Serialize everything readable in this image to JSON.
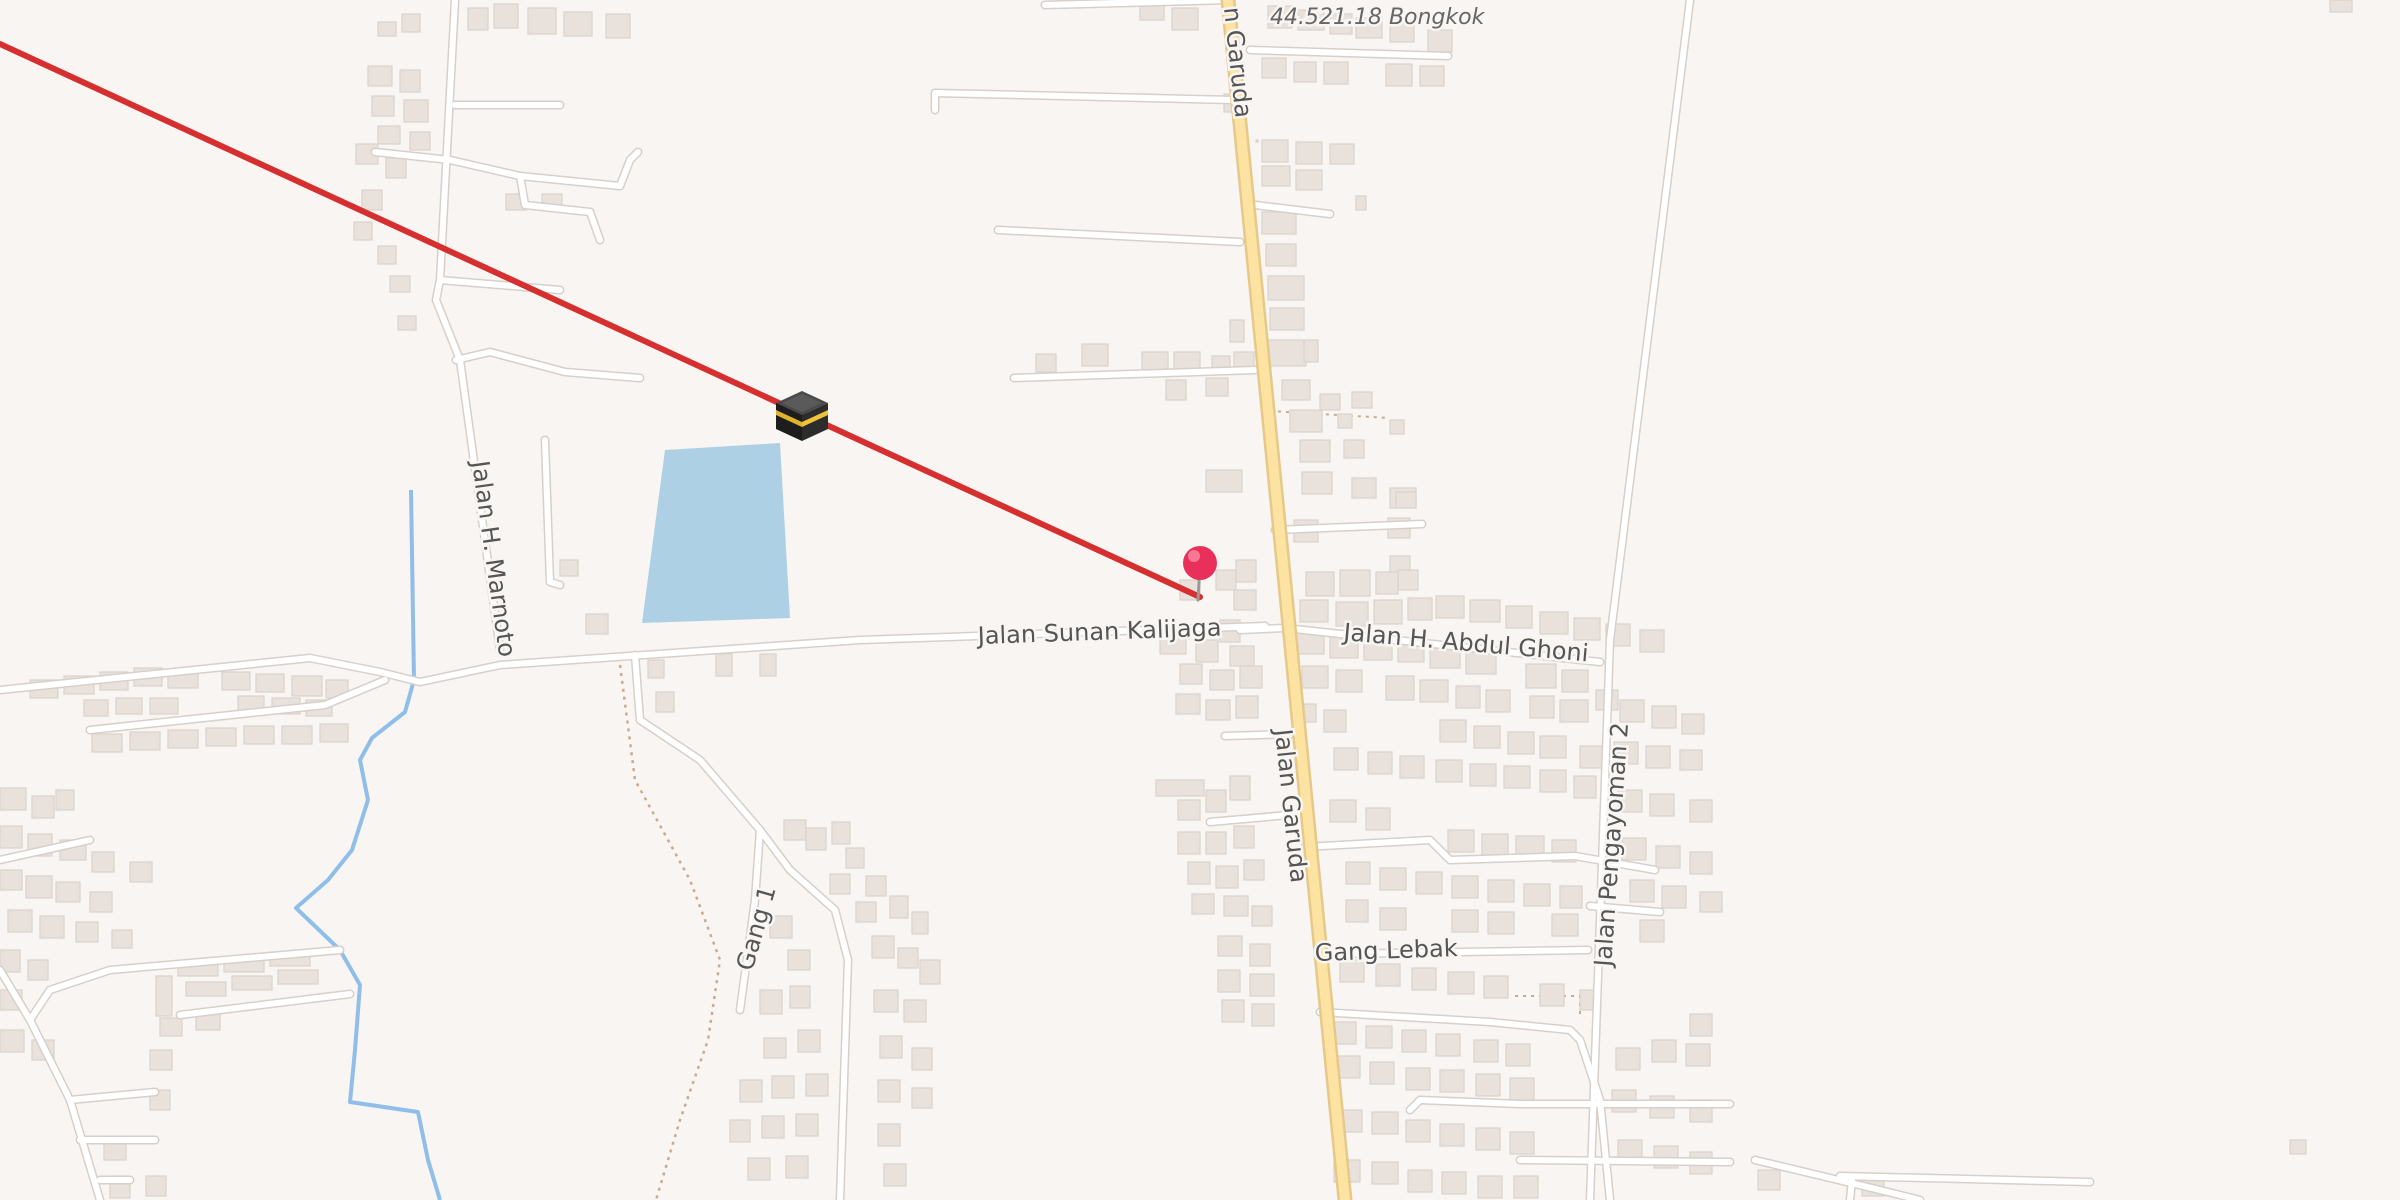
{
  "map": {
    "labels": {
      "address": "44.521.18 Bongkok",
      "road_garuda_top": "n Garuda",
      "road_garuda": "Jalan Garuda",
      "road_sunan_kalijaga": "Jalan Sunan Kalijaga",
      "road_abdul_ghoni": "Jalan H. Abdul Ghoni",
      "road_marnoto": "Jalan H. Marnoto",
      "road_pengayoman": "Jalan Pengayoman 2",
      "road_gang1": "Gang 1",
      "road_gang_lebak": "Gang Lebak"
    },
    "markers": {
      "kaaba": "kaaba-icon",
      "location_pin": "map-pin-icon"
    },
    "colors": {
      "qibla_line": "#d62f2f",
      "water": "#aed0e5",
      "stream": "#8fbfe8",
      "main_road": "#fde3a1",
      "pin": "#e8305a",
      "background": "#f8f5f2"
    }
  }
}
